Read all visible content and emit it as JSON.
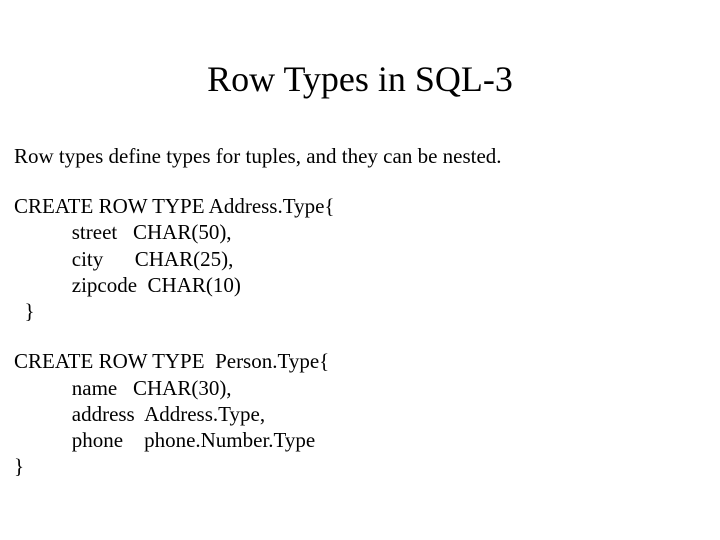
{
  "title": "Row Types in SQL-3",
  "subtitle": "Row types define types for tuples, and they can be nested.",
  "block1": {
    "l1": "CREATE ROW TYPE Address.Type{",
    "l2": "           street   CHAR(50),",
    "l3": "           city      CHAR(25),",
    "l4": "           zipcode  CHAR(10)",
    "l5": "  }"
  },
  "block2": {
    "l1": "CREATE ROW TYPE  Person.Type{",
    "l2": "           name   CHAR(30),",
    "l3": "           address  Address.Type,",
    "l4": "           phone    phone.Number.Type",
    "l5": "}"
  }
}
